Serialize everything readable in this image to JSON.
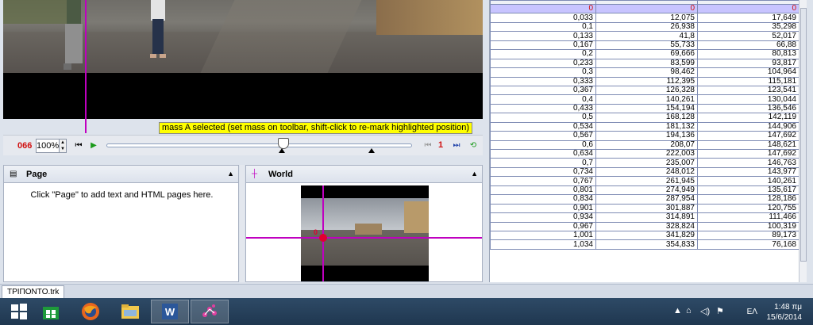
{
  "player": {
    "frame_number": "066",
    "zoom": "100%",
    "step_number": "1",
    "status_message": "mass A selected (set mass on toolbar, shift-click to re-mark highlighted position)",
    "progress_fraction": 0.58
  },
  "page_panel": {
    "title": "Page",
    "hint": "Click \"Page\" to add text and HTML pages here."
  },
  "world_panel": {
    "title": "World",
    "point_label": "0"
  },
  "table": {
    "header_row": [
      "0",
      "0",
      "0"
    ],
    "rows": [
      [
        "0,033",
        "12,075",
        "17,649"
      ],
      [
        "0,1",
        "26,938",
        "35,298"
      ],
      [
        "0,133",
        "41,8",
        "52,017"
      ],
      [
        "0,167",
        "55,733",
        "66,88"
      ],
      [
        "0,2",
        "69,666",
        "80,813"
      ],
      [
        "0,233",
        "83,599",
        "93,817"
      ],
      [
        "0,3",
        "98,462",
        "104,964"
      ],
      [
        "0,333",
        "112,395",
        "115,181"
      ],
      [
        "0,367",
        "126,328",
        "123,541"
      ],
      [
        "0,4",
        "140,261",
        "130,044"
      ],
      [
        "0,433",
        "154,194",
        "136,546"
      ],
      [
        "0,5",
        "168,128",
        "142,119"
      ],
      [
        "0,534",
        "181,132",
        "144,906"
      ],
      [
        "0,567",
        "194,136",
        "147,692"
      ],
      [
        "0,6",
        "208,07",
        "148,621"
      ],
      [
        "0,634",
        "222,003",
        "147,692"
      ],
      [
        "0,7",
        "235,007",
        "146,763"
      ],
      [
        "0,734",
        "248,012",
        "143,977"
      ],
      [
        "0,767",
        "261,945",
        "140,261"
      ],
      [
        "0,801",
        "274,949",
        "135,617"
      ],
      [
        "0,834",
        "287,954",
        "128,186"
      ],
      [
        "0,901",
        "301,887",
        "120,755"
      ],
      [
        "0,934",
        "314,891",
        "111,466"
      ],
      [
        "0,967",
        "328,824",
        "100,319"
      ],
      [
        "1,001",
        "341,829",
        "89,173"
      ],
      [
        "1,034",
        "354,833",
        "76,168"
      ]
    ]
  },
  "tabs": {
    "file": "ΤΡΙΠΟΝΤΟ.trk"
  },
  "taskbar": {
    "apps": [
      "start-icon",
      "store-icon",
      "firefox-icon",
      "explorer-icon",
      "word-icon",
      "tracker-icon"
    ],
    "language": "ΕΛ",
    "time": "1:48 πμ",
    "date": "15/6/2014"
  },
  "colors": {
    "track_line": "#c000c0",
    "point": "#e00030",
    "header_bg": "#c8c4ff",
    "status_bg": "#ffff00"
  }
}
